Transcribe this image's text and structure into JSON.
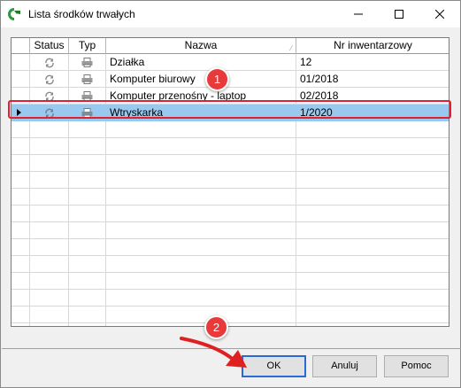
{
  "window": {
    "title": "Lista środków trwałych",
    "controls": [
      "minimize-icon",
      "maximize-icon",
      "close-icon"
    ]
  },
  "grid": {
    "columns": [
      {
        "key": "status",
        "label": "Status"
      },
      {
        "key": "typ",
        "label": "Typ"
      },
      {
        "key": "nazwa",
        "label": "Nazwa"
      },
      {
        "key": "nr",
        "label": "Nr inwentarzowy"
      }
    ],
    "rows": [
      {
        "status_icon": "refresh-icon",
        "type_icon": "printer-icon",
        "nazwa": "Działka",
        "nr": "12"
      },
      {
        "status_icon": "refresh-icon",
        "type_icon": "printer-icon",
        "nazwa": "Komputer biurowy",
        "nr": "01/2018"
      },
      {
        "status_icon": "refresh-icon",
        "type_icon": "printer-icon",
        "nazwa": "Komputer przenośny - laptop",
        "nr": "02/2018"
      },
      {
        "status_icon": "refresh-icon",
        "type_icon": "printer-icon",
        "nazwa": "Wtryskarka",
        "nr": "1/2020"
      }
    ],
    "selected_row": 3
  },
  "buttons": {
    "ok": "OK",
    "anuluj": "Anuluj",
    "pomoc": "Pomoc"
  },
  "annotations": {
    "badge1": "1",
    "badge2": "2"
  },
  "colors": {
    "selection": "#99c9ef",
    "annotation_red": "#e83a3a",
    "outline_red": "#e02030",
    "default_button_border": "#2a6ad4"
  }
}
